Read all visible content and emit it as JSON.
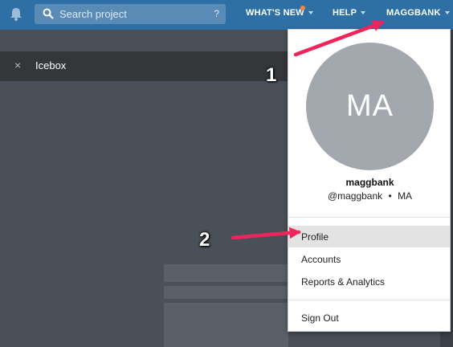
{
  "topbar": {
    "search_placeholder": "Search project",
    "search_help": "?",
    "nav": {
      "whats_new": "WHAT'S NEW",
      "help": "HELP",
      "user": "MAGGBANK"
    },
    "colors": {
      "bar": "#2e6fa6",
      "notif_dot": "#f28a35"
    }
  },
  "panel": {
    "title": "Icebox",
    "close_symbol": "×"
  },
  "dropdown": {
    "avatar_initials": "MA",
    "username": "maggbank",
    "handle": "@maggbank",
    "separator": "•",
    "initials": "MA",
    "menu": [
      {
        "label": "Profile",
        "active": true
      },
      {
        "label": "Accounts",
        "active": false
      },
      {
        "label": "Reports & Analytics",
        "active": false
      }
    ],
    "sign_out": "Sign Out"
  },
  "annotations": {
    "step1": "1",
    "step2": "2",
    "arrow_color": "#f0245c"
  },
  "icons": {
    "bell": "bell-icon",
    "search": "search-icon",
    "close": "close-icon"
  }
}
